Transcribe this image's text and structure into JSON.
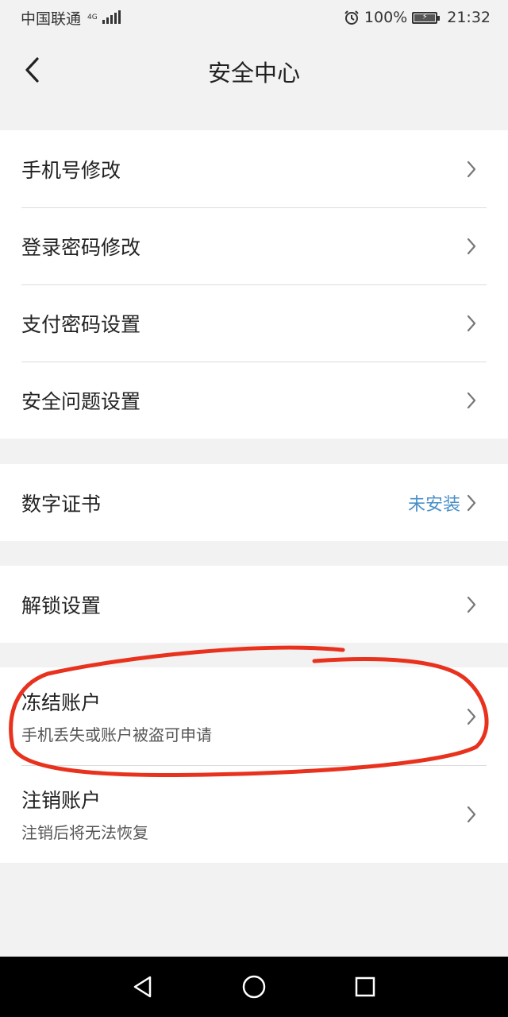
{
  "status_bar": {
    "carrier": "中国联通",
    "network_type": "4G",
    "battery_percent": "100%",
    "time": "21:32"
  },
  "header": {
    "title": "安全中心",
    "back_icon": "chevron-left-icon"
  },
  "sections": {
    "account": [
      {
        "label": "手机号修改"
      },
      {
        "label": "登录密码修改"
      },
      {
        "label": "支付密码设置"
      },
      {
        "label": "安全问题设置"
      }
    ],
    "certificate": {
      "label": "数字证书",
      "value": "未安装"
    },
    "unlock": {
      "label": "解锁设置"
    },
    "danger": [
      {
        "label": "冻结账户",
        "sub": "手机丢失或账户被盗可申请"
      },
      {
        "label": "注销账户",
        "sub": "注销后将无法恢复"
      }
    ]
  },
  "colors": {
    "background": "#f2f2f2",
    "value_accent": "#4a90c8",
    "annotation_red": "#e8321e"
  },
  "nav_bar": {
    "icons": [
      "back-triangle-icon",
      "home-circle-icon",
      "recents-square-icon"
    ]
  }
}
